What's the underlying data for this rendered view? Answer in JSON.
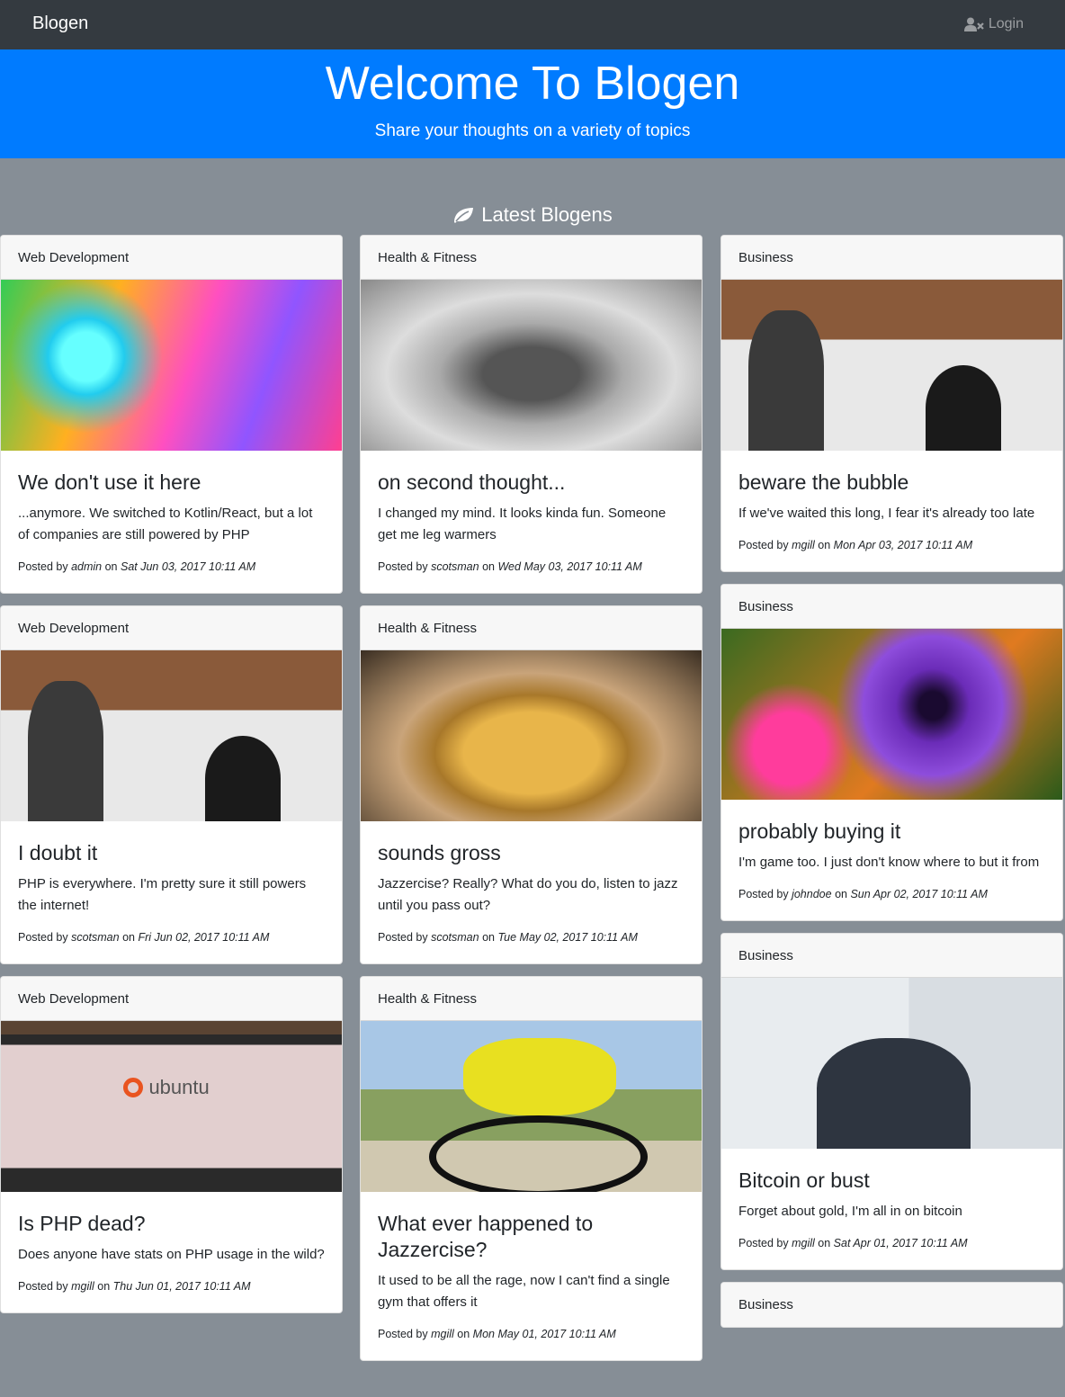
{
  "navbar": {
    "brand": "Blogen",
    "login_label": "Login",
    "login_icon": "user-times-icon"
  },
  "header": {
    "title": "Welcome To Blogen",
    "subtitle": "Share your thoughts on a variety of topics"
  },
  "section": {
    "title": "Latest Blogens",
    "icon": "leaf-icon"
  },
  "colors": {
    "navbar": "#343a40",
    "header": "#007bff",
    "page_bg": "#868e96"
  },
  "posts": [
    {
      "category": "Web Development",
      "title": "We don't use it here",
      "text": "...anymore. We switched to Kotlin/React, but a lot of companies are still powered by PHP",
      "posted_prefix": "Posted by",
      "author": "admin",
      "on": "on",
      "date": "Sat Jun 03, 2017 10:11 AM"
    },
    {
      "category": "Health & Fitness",
      "title": "on second thought...",
      "text": "I changed my mind. It looks kinda fun. Someone get me leg warmers",
      "posted_prefix": "Posted by",
      "author": "scotsman",
      "on": "on",
      "date": "Wed May 03, 2017 10:11 AM"
    },
    {
      "category": "Business",
      "title": "beware the bubble",
      "text": "If we've waited this long, I fear it's already too late",
      "posted_prefix": "Posted by",
      "author": "mgill",
      "on": "on",
      "date": "Mon Apr 03, 2017 10:11 AM"
    },
    {
      "category": "Web Development",
      "title": "I doubt it",
      "text": "PHP is everywhere. I'm pretty sure it still powers the internet!",
      "posted_prefix": "Posted by",
      "author": "scotsman",
      "on": "on",
      "date": "Fri Jun 02, 2017 10:11 AM"
    },
    {
      "category": "Health & Fitness",
      "title": "sounds gross",
      "text": "Jazzercise? Really? What do you do, listen to jazz until you pass out?",
      "posted_prefix": "Posted by",
      "author": "scotsman",
      "on": "on",
      "date": "Tue May 02, 2017 10:11 AM"
    },
    {
      "category": "Business",
      "title": "probably buying it",
      "text": "I'm game too. I just don't know where to but it from",
      "posted_prefix": "Posted by",
      "author": "johndoe",
      "on": "on",
      "date": "Sun Apr 02, 2017 10:11 AM"
    },
    {
      "category": "Web Development",
      "title": "Is PHP dead?",
      "text": "Does anyone have stats on PHP usage in the wild?",
      "posted_prefix": "Posted by",
      "author": "mgill",
      "on": "on",
      "date": "Thu Jun 01, 2017 10:11 AM"
    },
    {
      "category": "Health & Fitness",
      "title": "What ever happened to Jazzercise?",
      "text": "It used to be all the rage, now I can't find a single gym that offers it",
      "posted_prefix": "Posted by",
      "author": "mgill",
      "on": "on",
      "date": "Mon May 01, 2017 10:11 AM"
    },
    {
      "category": "Business",
      "title": "Bitcoin or bust",
      "text": "Forget about gold, I'm all in on bitcoin",
      "posted_prefix": "Posted by",
      "author": "mgill",
      "on": "on",
      "date": "Sat Apr 01, 2017 10:11 AM"
    },
    {
      "category": "Business"
    }
  ],
  "image_labels": {
    "ubuntu": "ubuntu"
  }
}
